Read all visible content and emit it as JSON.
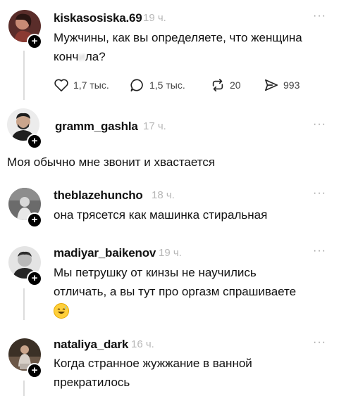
{
  "posts": [
    {
      "username": "kiskasosiska.69",
      "time": "19 ч.",
      "more": "···",
      "text": "Мужчины, как вы определяете, что женщина конч*ла?",
      "text_line1": "Мужчины, как вы определяете, что женщина",
      "text_line2": "конч",
      "text_censored": "и",
      "text_line2_end": "ла?",
      "actions": {
        "likes": "1,7 тыс.",
        "comments": "1,5 тыс.",
        "reposts": "20",
        "shares": "993"
      }
    },
    {
      "username": "gramm_gashla",
      "time": "17 ч.",
      "more": "···",
      "text": "Моя обычно мне звонит и хвастается"
    },
    {
      "username": "theblazehuncho",
      "time": "18 ч.",
      "more": "···",
      "text": "она трясется как машинка стиральная"
    },
    {
      "username": "madiyar_baikenov",
      "time": "19 ч.",
      "more": "···",
      "text_line1": "Мы петрушку от кинзы не научились",
      "text_line2": "отличать, а вы тут про оргазм спрашиваете"
    },
    {
      "username": "nataliya_dark",
      "time": "16 ч.",
      "more": "···",
      "text_line1": "Когда странное жужжание в ванной",
      "text_line2": "прекратилось"
    }
  ],
  "icons": [
    "heart-icon",
    "comment-icon",
    "repost-icon",
    "share-icon",
    "more-icon",
    "plus-icon",
    "sweat-smile-emoji"
  ],
  "colors": {
    "time": "#b7b7b7",
    "text": "#111111",
    "thread": "#dcdcdc"
  }
}
